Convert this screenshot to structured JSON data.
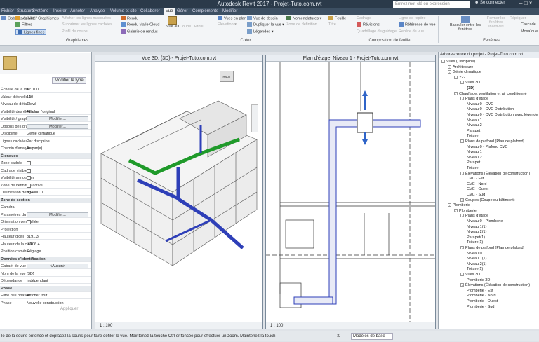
{
  "titlebar": {
    "app_title": "Autodesk Revit 2017 -   Projet-Tuto.com.rvt",
    "search_placeholder": "Entrez mot-clé ou expression",
    "login": "Se connecter"
  },
  "tabs": [
    "Fichier",
    "Structure",
    "Système",
    "Insérer",
    "Annoter",
    "Analyse",
    "Volume et site",
    "Collaborer",
    "Vue",
    "Gérer",
    "Compléments",
    "Modifier"
  ],
  "active_tab": "Vue",
  "ribbon": {
    "graphismes": {
      "label": "Graphismes",
      "items": [
        "Gabarits de vue",
        "Visibilité/ Graphismes",
        "Filtres",
        "Lignes fines",
        "Afficher les lignes masquées",
        "Supprimer les lignes cachées",
        "Profil de coupe",
        "Rendu",
        "Rendu via le Cloud",
        "Galerie de rendus"
      ]
    },
    "creer": {
      "label": "Créer",
      "items": [
        "Vue 3D",
        "Coupe",
        "Profil",
        "Vue de dessin",
        "Dupliquer la vue",
        "Légendes",
        "Nomenclatures",
        "Vues en plan",
        "Élévation",
        "Zone de définition"
      ]
    },
    "composition": {
      "label": "Composition de feuille",
      "items": [
        "Feuille",
        "Titre",
        "Révisions",
        "Cadrage",
        "Ligne de repère",
        "Repère de vue",
        "Quadrillage de guidage",
        "Référence de vue"
      ]
    },
    "fenetres": {
      "label": "Fenêtres",
      "items": [
        "Basculer entre les fenêtres",
        "Fermer les fenêtres inactives",
        "Répliquer",
        "Cascade",
        "Mosaïque"
      ]
    }
  },
  "properties": {
    "edit_type": "Modifier le type",
    "rows": [
      {
        "k": "Échelle de la vue",
        "v": "1 : 100"
      },
      {
        "k": "Valeur d'échelle 1:",
        "v": "100"
      },
      {
        "k": "Niveau de détail",
        "v": "Élevé"
      },
      {
        "k": "Visibilité des éléments",
        "v": "Afficher l'original"
      },
      {
        "k": "Visibilité / graph...",
        "v": "Modifier..."
      },
      {
        "k": "Options des graphis...",
        "v": "Modifier..."
      },
      {
        "k": "Discipline",
        "v": "Génie climatique"
      },
      {
        "k": "Lignes cachées",
        "v": "Par discipline"
      },
      {
        "k": "Chemin d'analyse par...",
        "v": "Aucun(e)"
      },
      {
        "k": "Étendues",
        "v": ""
      },
      {
        "k": "Zone cadrée",
        "v": ""
      },
      {
        "k": "Cadrage visible",
        "v": ""
      },
      {
        "k": "Visibilité annotation",
        "v": ""
      },
      {
        "k": "Zone de définition active",
        "v": ""
      },
      {
        "k": "Délimitation désig...",
        "v": "304800.0"
      },
      {
        "k": "Zone de section",
        "v": ""
      },
      {
        "k": "Caméra",
        "v": ""
      },
      {
        "k": "Paramètres du rendu",
        "v": "Modifier..."
      },
      {
        "k": "Orientation verrouillée",
        "v": ""
      },
      {
        "k": "Projection",
        "v": ""
      },
      {
        "k": "Hauteur d'œil",
        "v": "3191.3"
      },
      {
        "k": "Hauteur de la cible",
        "v": "-4106.4"
      },
      {
        "k": "Position caméra",
        "v": "Réglage"
      },
      {
        "k": "Données d'identification",
        "v": ""
      },
      {
        "k": "Gabarit de vue",
        "v": "<Aucun>"
      },
      {
        "k": "Nom de la vue",
        "v": "{3D}"
      },
      {
        "k": "Dépendance",
        "v": "Indépendant"
      },
      {
        "k": "Phase",
        "v": ""
      },
      {
        "k": "Filtre des phases",
        "v": "Afficher tout"
      },
      {
        "k": "Phase",
        "v": "Nouvelle construction"
      }
    ],
    "apply": "Appliquer"
  },
  "view3d": {
    "title": "Vue 3D: {3D} - Projet-Tuto.com.rvt",
    "scale": "1 : 100",
    "cube_label": "HAUT"
  },
  "viewplan": {
    "title": "Plan d'étage: Niveau 1 - Projet-Tuto.com.rvt",
    "scale": "1 : 100"
  },
  "browser": {
    "title": "Arborescence du projet - Projet-Tuto.com.rvt",
    "items": [
      {
        "d": 0,
        "t": "Vues (Discipline)",
        "tog": "-"
      },
      {
        "d": 1,
        "t": "Architecture",
        "tog": "+"
      },
      {
        "d": 1,
        "t": "Génie climatique",
        "tog": "-"
      },
      {
        "d": 2,
        "t": "???",
        "tog": "-"
      },
      {
        "d": 3,
        "t": "Vues 3D",
        "tog": "-"
      },
      {
        "d": 4,
        "t": "{3D}",
        "tog": "",
        "bold": true
      },
      {
        "d": 2,
        "t": "Chauffage, ventilation et air conditionné",
        "tog": "-"
      },
      {
        "d": 3,
        "t": "Plans d'étage",
        "tog": "-"
      },
      {
        "d": 4,
        "t": "Niveau 0 - CVC",
        "tog": ""
      },
      {
        "d": 4,
        "t": "Niveau 0 - CVC Distribution",
        "tog": ""
      },
      {
        "d": 4,
        "t": "Niveau 0 - CVC Distribution avec légende",
        "tog": ""
      },
      {
        "d": 4,
        "t": "Niveau 1",
        "tog": ""
      },
      {
        "d": 4,
        "t": "Niveau 2",
        "tog": ""
      },
      {
        "d": 4,
        "t": "Parapet",
        "tog": ""
      },
      {
        "d": 4,
        "t": "Toiture",
        "tog": ""
      },
      {
        "d": 3,
        "t": "Plans de plafond (Plan de plafond)",
        "tog": "-"
      },
      {
        "d": 4,
        "t": "Niveau 0 - Plafond CVC",
        "tog": ""
      },
      {
        "d": 4,
        "t": "Niveau 1",
        "tog": ""
      },
      {
        "d": 4,
        "t": "Niveau 2",
        "tog": ""
      },
      {
        "d": 4,
        "t": "Parapet",
        "tog": ""
      },
      {
        "d": 4,
        "t": "Toiture",
        "tog": ""
      },
      {
        "d": 3,
        "t": "Élévations (Élévation de construction)",
        "tog": "-"
      },
      {
        "d": 4,
        "t": "CVC - Est",
        "tog": ""
      },
      {
        "d": 4,
        "t": "CVC - Nord",
        "tog": ""
      },
      {
        "d": 4,
        "t": "CVC - Ouest",
        "tog": ""
      },
      {
        "d": 4,
        "t": "CVC - Sud",
        "tog": ""
      },
      {
        "d": 3,
        "t": "Coupes (Coupe du bâtiment)",
        "tog": "+"
      },
      {
        "d": 1,
        "t": "Plomberie",
        "tog": "-"
      },
      {
        "d": 2,
        "t": "Plomberie",
        "tog": "-"
      },
      {
        "d": 3,
        "t": "Plans d'étage",
        "tog": "-"
      },
      {
        "d": 4,
        "t": "Niveau 0 - Plomberie",
        "tog": ""
      },
      {
        "d": 4,
        "t": "Niveau 1(1)",
        "tog": ""
      },
      {
        "d": 4,
        "t": "Niveau 2(1)",
        "tog": ""
      },
      {
        "d": 4,
        "t": "Parapet(1)",
        "tog": ""
      },
      {
        "d": 4,
        "t": "Toiture(1)",
        "tog": ""
      },
      {
        "d": 3,
        "t": "Plans de plafond (Plan de plafond)",
        "tog": "-"
      },
      {
        "d": 4,
        "t": "Niveau 0",
        "tog": ""
      },
      {
        "d": 4,
        "t": "Niveau 1(1)",
        "tog": ""
      },
      {
        "d": 4,
        "t": "Niveau 2(1)",
        "tog": ""
      },
      {
        "d": 4,
        "t": "Toiture(1)",
        "tog": ""
      },
      {
        "d": 3,
        "t": "Vues 3D",
        "tog": "-"
      },
      {
        "d": 4,
        "t": "Plomberie 3D",
        "tog": ""
      },
      {
        "d": 3,
        "t": "Élévations (Élévation de construction)",
        "tog": "-"
      },
      {
        "d": 4,
        "t": "Plomberie - Est",
        "tog": ""
      },
      {
        "d": 4,
        "t": "Plomberie - Nord",
        "tog": ""
      },
      {
        "d": 4,
        "t": "Plomberie - Ouest",
        "tog": ""
      },
      {
        "d": 4,
        "t": "Plomberie - Sud",
        "tog": ""
      }
    ]
  },
  "status": {
    "hint": "le de la souris enfoncé et déplacez la souris pour faire défiler la vue. Maintenez la touche Ctrl enfoncée pour effectuer un zoom. Maintenez la touch",
    "zero": ":0",
    "model": "Modèles de base"
  },
  "colors": {
    "duct": "#2e3fb8",
    "duct_green": "#1f9a2a",
    "selection": "#2f64c8"
  }
}
